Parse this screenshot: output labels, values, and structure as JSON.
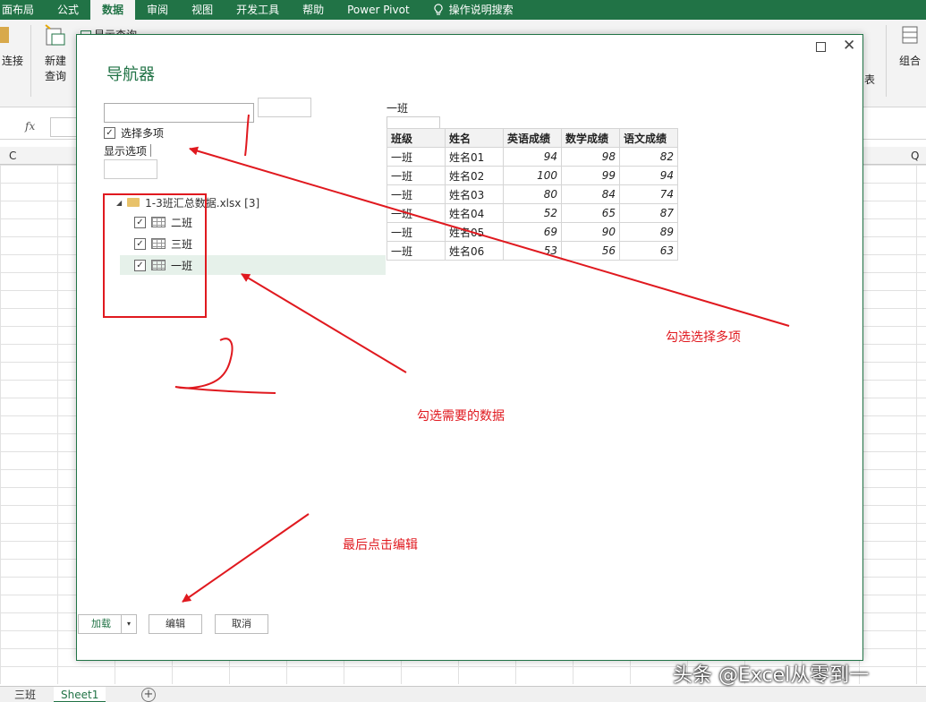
{
  "ribbon": {
    "tabs": [
      "面布局",
      "公式",
      "数据",
      "审阅",
      "视图",
      "开发工具",
      "帮助",
      "Power Pivot",
      "操作说明搜索"
    ],
    "active_tab": "数据",
    "connect_label": "连接",
    "new_query_label": "新建",
    "new_query_label2": "查询",
    "show_query_label": "显示查询",
    "group_label": "组合",
    "table_label": "表",
    "accent_color": "#217346"
  },
  "formula_bar": {
    "fx": "fx"
  },
  "grid": {
    "col_c": "C",
    "col_q": "Q"
  },
  "sheets": {
    "tab1": "三班",
    "tab2": "Sheet1"
  },
  "dialog": {
    "title": "导航器",
    "multi_select_label": "选择多项",
    "display_options_label": "显示选项",
    "tree": {
      "root": "1-3班汇总数据.xlsx [3]",
      "items": [
        "二班",
        "三班",
        "一班"
      ]
    },
    "preview_title": "一班",
    "preview": {
      "headers": [
        "班级",
        "姓名",
        "英语成绩",
        "数学成绩",
        "语文成绩"
      ],
      "rows": [
        [
          "一班",
          "姓名01",
          "94",
          "98",
          "82"
        ],
        [
          "一班",
          "姓名02",
          "100",
          "99",
          "94"
        ],
        [
          "一班",
          "姓名03",
          "80",
          "84",
          "74"
        ],
        [
          "一班",
          "姓名04",
          "52",
          "65",
          "87"
        ],
        [
          "一班",
          "姓名05",
          "69",
          "90",
          "89"
        ],
        [
          "一班",
          "姓名06",
          "53",
          "56",
          "63"
        ]
      ]
    },
    "buttons": {
      "load": "加载",
      "edit": "编辑",
      "cancel": "取消"
    }
  },
  "annotations": {
    "multi_select_note": "勾选选择多项",
    "data_note": "勾选需要的数据",
    "edit_note": "最后点击编辑",
    "color": "#e0191f"
  },
  "watermark": "头条 @Excel从零到一"
}
